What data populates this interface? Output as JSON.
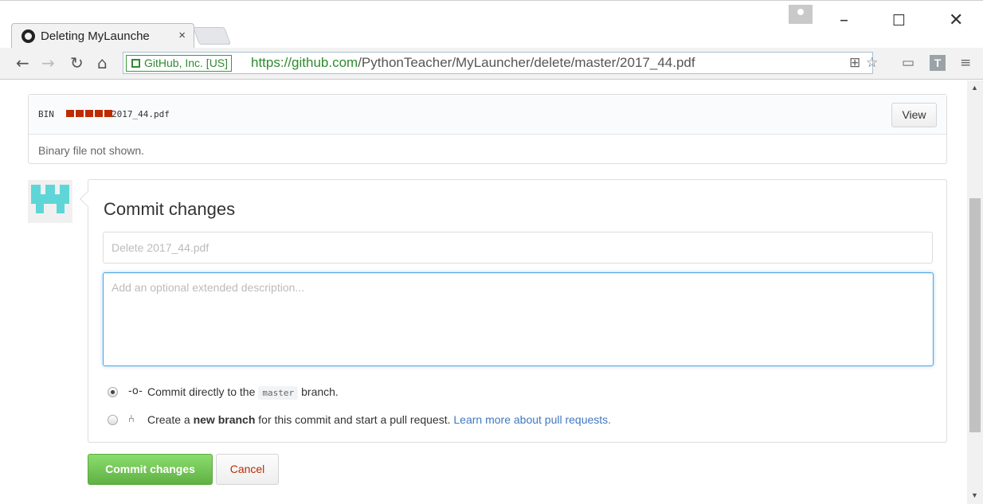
{
  "browser": {
    "tab_title": "Deleting MyLaunche",
    "tab_close": "×",
    "security_label": "GitHub, Inc. [US]",
    "url_scheme": "https://",
    "url_host": "github.com",
    "url_path": "/PythonTeacher/MyLauncher/delete/master/2017_44.pdf",
    "extension_label": "T"
  },
  "file": {
    "bin_label": "BIN",
    "filename": "2017_44.pdf",
    "view_label": "View",
    "binary_message": "Binary file not shown."
  },
  "commit": {
    "title": "Commit changes",
    "summary_placeholder": "Delete 2017_44.pdf",
    "description_placeholder": "Add an optional extended description...",
    "option_direct_prefix": "Commit directly to the",
    "branch_name": "master",
    "option_direct_suffix": "branch.",
    "option_new_prefix": "Create a",
    "option_new_bold": "new branch",
    "option_new_suffix": "for this commit and start a pull request.",
    "learn_more_link": "Learn more about pull requests.",
    "selected_option": "direct",
    "commit_button": "Commit changes",
    "cancel_button": "Cancel"
  },
  "colors": {
    "commit_button_green": "#6cc644",
    "cancel_text_red": "#bd2c00",
    "link_blue": "#4078c0",
    "secure_green": "#2e8b2e"
  }
}
